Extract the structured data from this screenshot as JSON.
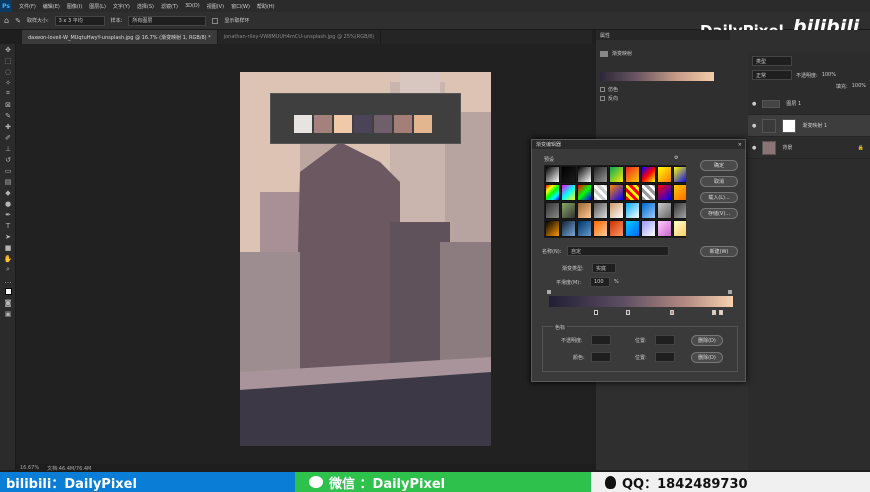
{
  "menu": {
    "app_icon": "Ps",
    "items": [
      "文件(F)",
      "编辑(E)",
      "图像(I)",
      "图层(L)",
      "文字(Y)",
      "选择(S)",
      "滤镜(T)",
      "3D(D)",
      "视图(V)",
      "窗口(W)",
      "帮助(H)"
    ]
  },
  "options": {
    "sample_size_label": "取样大小:",
    "sample_size_value": "3 x 3 平均",
    "sample_label": "样本:",
    "sample_value": "所有图层",
    "ring_label": "显示取样环"
  },
  "tabs": [
    "daxeon-lovell-W_MUqtuHwyY-unsplash.jpg @ 16.7% (渐变映射 1, RGB/8) *",
    "jonathan-riley-VW8MUUH4mCU-unsplash.jpg @ 25%(RGB/8)"
  ],
  "status": {
    "zoom": "16.67%",
    "doc": "文档:46.4M/76.4M"
  },
  "palette": {
    "colors": [
      "#e7e3e1",
      "#a4817a",
      "#f0c9a8",
      "#4b4358",
      "#6e5f6a",
      "#a37f78",
      "#e4b690"
    ]
  },
  "watermark": {
    "brand": "DailyPixel",
    "bili": "bilibili"
  },
  "properties_panel": {
    "tab": "属性",
    "title": "渐变映射",
    "dither_label": "仿色",
    "reverse_label": "反向"
  },
  "layers_panel": {
    "kind": "类型",
    "mode": "正常",
    "opacity_label": "不透明度:",
    "opacity": "100%",
    "fill_label": "填充:",
    "fill": "100%",
    "layers": [
      {
        "name": "图层 1"
      },
      {
        "name": "渐变映射 1"
      },
      {
        "name": "背景"
      }
    ]
  },
  "gradient_dialog": {
    "title": "渐变编辑器",
    "presets_label": "预设",
    "ok": "确定",
    "cancel": "取消",
    "load": "载入(L)...",
    "save": "存储(V)...",
    "name_label": "名称(N):",
    "name_value": "自定",
    "new_button": "新建(W)",
    "type_label": "渐变类型:",
    "type_value": "实底",
    "smooth_label": "平滑度(M):",
    "smooth_value": "100",
    "percent": "%",
    "stops_label": "色标",
    "opacity_label": "不透明度:",
    "location_label": "位置:",
    "delete_label": "删除(D)",
    "color_label": "颜色:",
    "location2_label": "位置:",
    "delete2_label": "删除(D)"
  },
  "footer": {
    "bili_text": "bilibili：DailyPixel",
    "wechat_text": "微信 ：DailyPixel",
    "qq_text": "QQ：1842489730",
    "bili_color": "#0a7ed6",
    "wechat_color": "#2ec14b",
    "qq_color": "#f0f0f0"
  }
}
